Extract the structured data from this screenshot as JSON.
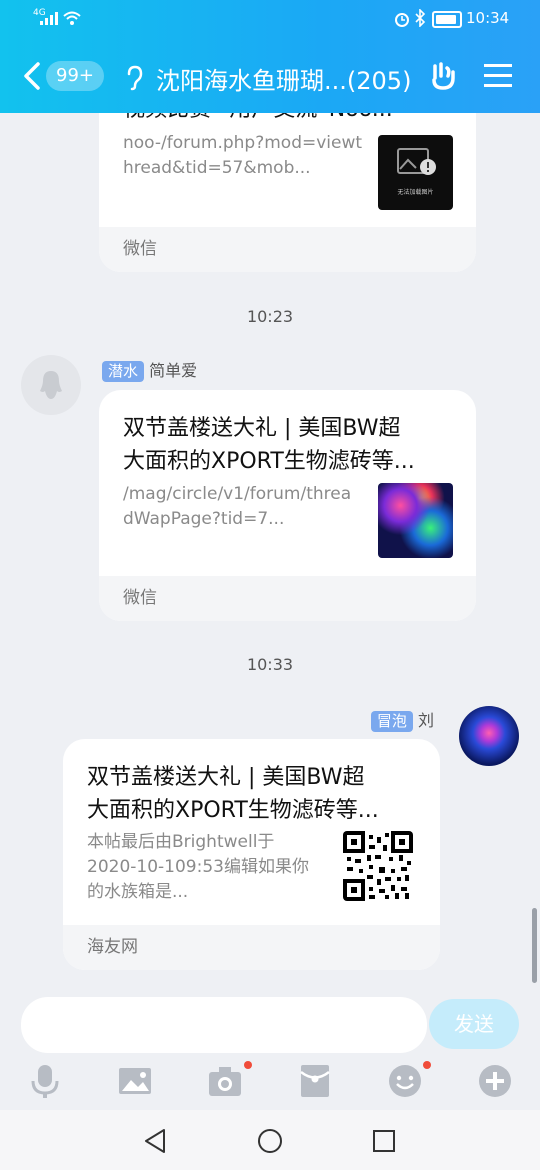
{
  "status_bar": {
    "network_label": "4G",
    "time": "10:34"
  },
  "header": {
    "unread_badge": "99+",
    "title": "沈阳海水鱼珊瑚...",
    "member_count": "(205)",
    "icons": [
      "back-chevron-icon",
      "earpiece-icon",
      "hand-gesture-icon",
      "menu-icon"
    ]
  },
  "messages": [
    {
      "type": "link_card",
      "title_partial": "视频比赛 “用户交流”Noo...",
      "description": "noo-/forum.php?mod=viewthread&tid=57&mob...",
      "thumb_label": "无法加载图片",
      "source": "微信"
    },
    {
      "type": "time",
      "text": "10:23"
    },
    {
      "type": "link_card",
      "sender_level": "潜水",
      "sender_name": "简单爱",
      "title_line1": "双节盖楼送大礼 | 美国BW超",
      "title_line2": "大面积的XPORT生物滤砖等...",
      "desc_line1": "/mag/circle/v1/forum/threa",
      "desc_line2": "dWapPage?tid=7...",
      "source": "微信"
    },
    {
      "type": "time",
      "text": "10:33"
    },
    {
      "type": "link_card",
      "sender_level": "冒泡",
      "sender_name": "刘",
      "title_line1": "双节盖楼送大礼 | 美国BW超",
      "title_line2": "大面积的XPORT生物滤砖等...",
      "desc_line1": "本帖最后由Brightwell于",
      "desc_line2": "2020-10-109:53编辑如果你",
      "desc_line3": "的水族箱是...",
      "source": "海友网"
    }
  ],
  "input": {
    "placeholder": "",
    "send_label": "发送"
  },
  "toolbar": [
    "microphone-icon",
    "image-icon",
    "camera-icon",
    "red-packet-icon",
    "emoji-icon",
    "plus-icon"
  ],
  "colors": {
    "header_start": "#12c2ee",
    "header_end": "#2aa1f7",
    "level_tag": "#7aa8ee",
    "send_button": "#c5ecfb",
    "notification_dot": "#f04c3a"
  }
}
